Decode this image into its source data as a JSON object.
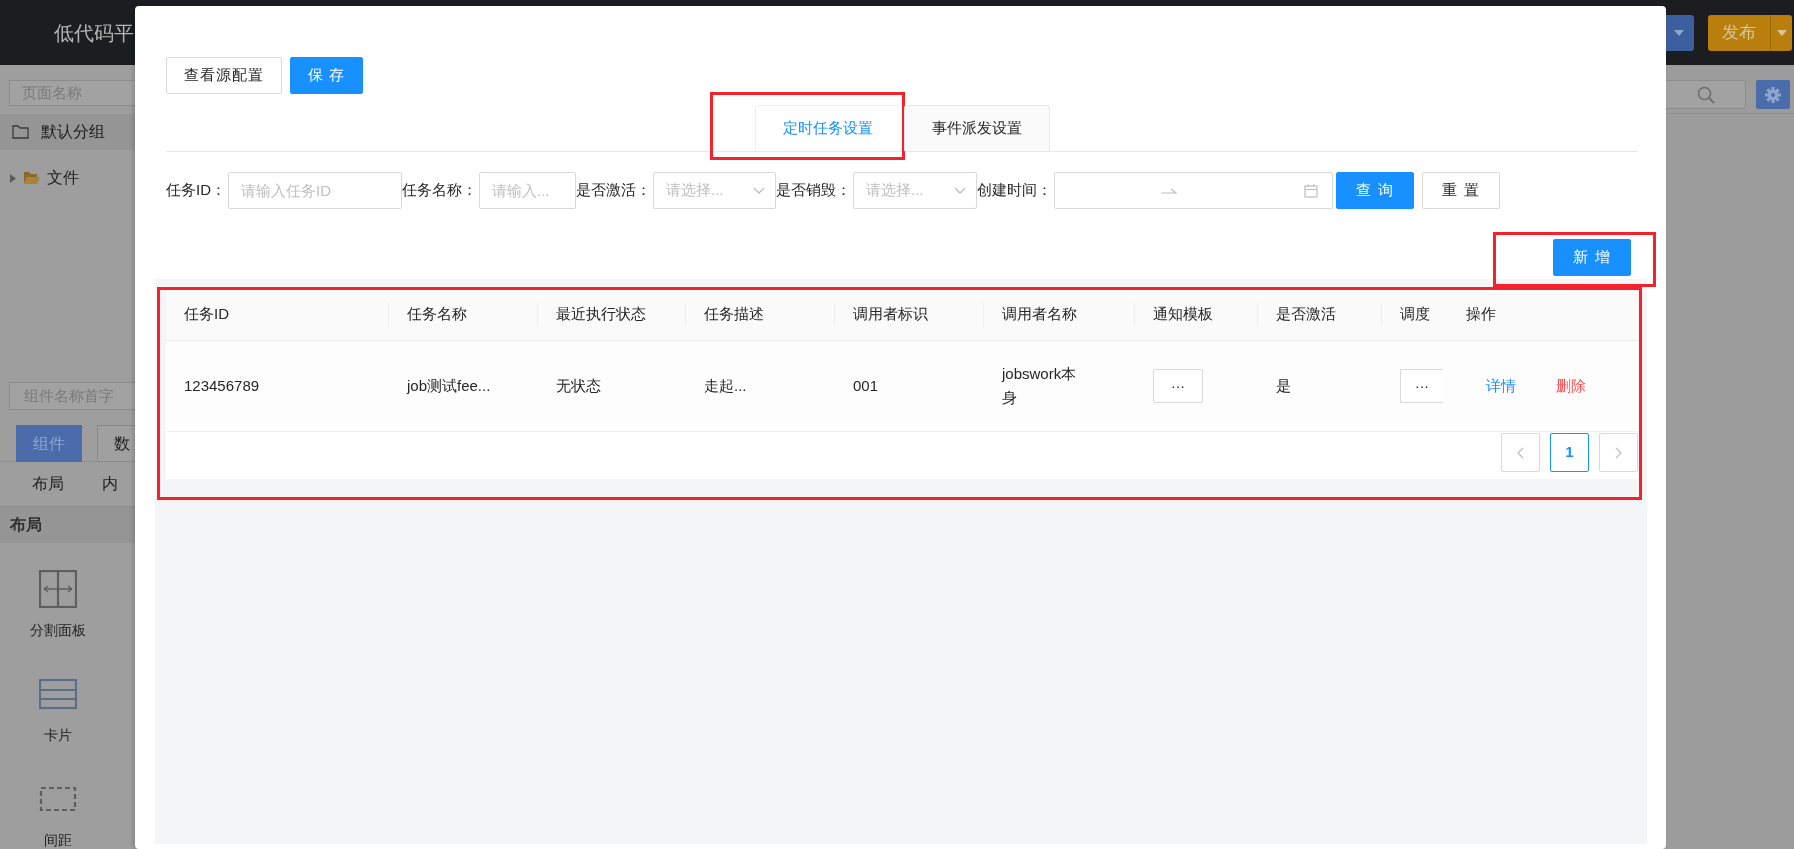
{
  "app": {
    "title": "低代码平",
    "topbar_buttons": [
      {
        "kind": "dropdown"
      },
      {
        "kind": "publish",
        "label": "发布"
      }
    ],
    "page_search": {
      "placeholder": "页面名称"
    },
    "group": {
      "label": "默认分组"
    },
    "tree": [
      {
        "label": "文件",
        "expanded": false
      }
    ],
    "component_search": {
      "placeholder": "组件名称首字"
    },
    "tabs": [
      {
        "label": "组件",
        "selected": true
      },
      {
        "label": "数",
        "selected": false
      }
    ],
    "categories": [
      {
        "label": "布局"
      },
      {
        "label": "内"
      }
    ],
    "section": "布局",
    "components": [
      {
        "label": "分割面板",
        "kind": "split"
      },
      {
        "label": "卡片",
        "kind": "card"
      },
      {
        "label": "间距",
        "kind": "spacer"
      }
    ]
  },
  "modal": {
    "buttons": [
      {
        "label": "查看源配置",
        "primary": false
      },
      {
        "label": "保 存",
        "primary": true
      }
    ],
    "tabs": [
      {
        "label": "定时任务设置",
        "selected": true,
        "highlighted": true
      },
      {
        "label": "事件派发设置",
        "selected": false,
        "highlighted": false
      }
    ],
    "filters": [
      {
        "label": "任务ID：",
        "kind": "input",
        "placeholder": "请输入任务ID"
      },
      {
        "label": "任务名称：",
        "kind": "input",
        "placeholder": "请输入..."
      },
      {
        "label": "是否激活：",
        "kind": "select",
        "placeholder": "请选择..."
      },
      {
        "label": "是否销毁：",
        "kind": "select",
        "placeholder": "请选择..."
      },
      {
        "label": "创建时间：",
        "kind": "daterange"
      }
    ],
    "actions": [
      {
        "label": "查 询",
        "primary": true
      },
      {
        "label": "重 置",
        "primary": false
      }
    ],
    "add_button": {
      "label": "新 增",
      "highlighted": true
    },
    "table": {
      "highlighted": true,
      "columns": [
        "任务ID",
        "任务名称",
        "最近执行状态",
        "任务描述",
        "调用者标识",
        "调用者名称",
        "通知模板",
        "是否激活",
        "调度",
        "操作"
      ],
      "rows": [
        {
          "cells": [
            {
              "kind": "text",
              "text": "123456789"
            },
            {
              "kind": "text",
              "text": "job测试fee..."
            },
            {
              "kind": "text",
              "text": "无状态"
            },
            {
              "kind": "text",
              "text": "走起..."
            },
            {
              "kind": "text",
              "text": "001"
            },
            {
              "kind": "text",
              "text": "jobswork本身"
            },
            {
              "kind": "button",
              "text": "···"
            },
            {
              "kind": "text",
              "text": "是"
            },
            {
              "kind": "button",
              "text": "···"
            }
          ],
          "actions": [
            {
              "label": "详情",
              "kind": "link"
            },
            {
              "label": "删除",
              "kind": "danger"
            }
          ]
        }
      ],
      "pagination": {
        "pages": [
          {
            "label": "1",
            "selected": true
          }
        ]
      }
    }
  }
}
